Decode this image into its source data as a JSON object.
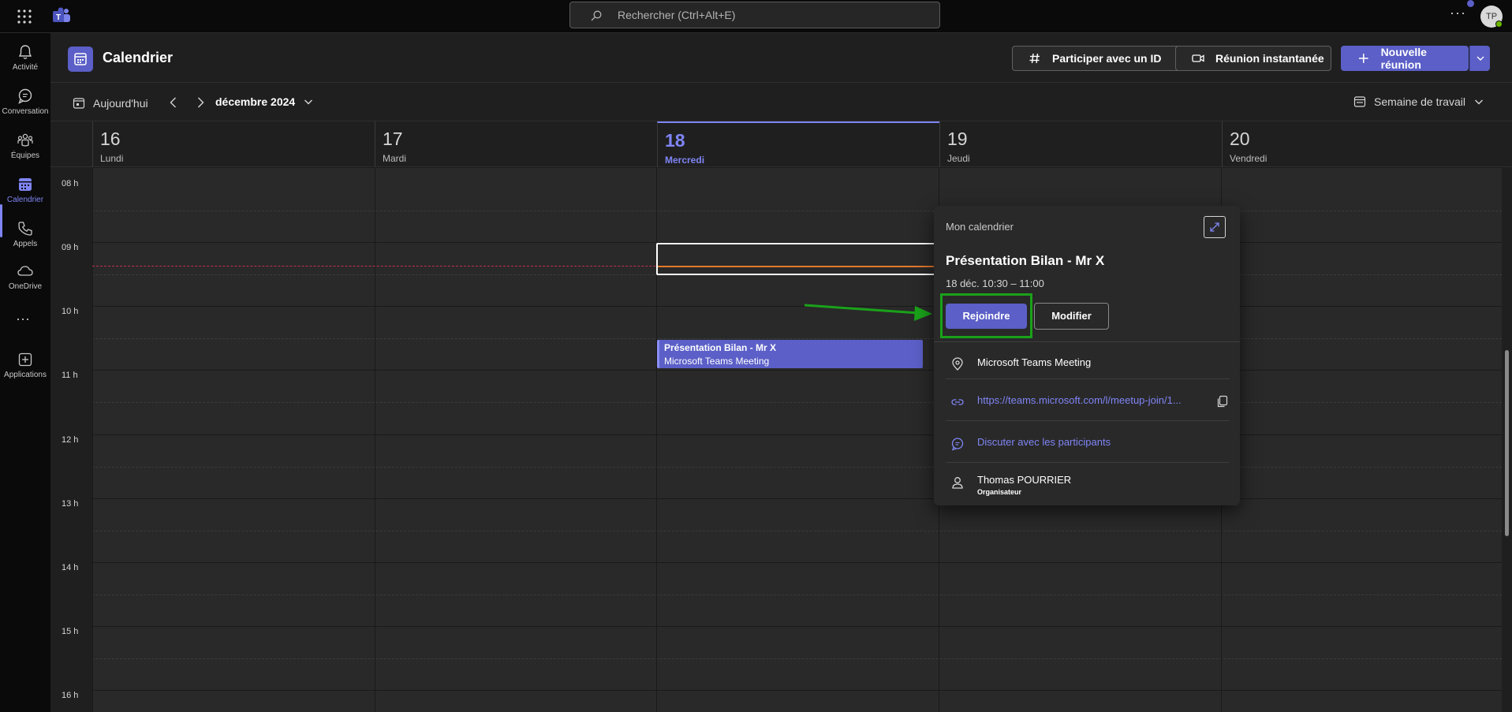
{
  "topbar": {
    "search_placeholder": "Rechercher (Ctrl+Alt+E)",
    "more": "···",
    "avatar_initials": "TP"
  },
  "rail": {
    "items": [
      {
        "label": "Activité",
        "icon": "bell-icon"
      },
      {
        "label": "Conversation",
        "icon": "chat-icon"
      },
      {
        "label": "Équipes",
        "icon": "teams-icon"
      },
      {
        "label": "Calendrier",
        "icon": "calendar-icon",
        "active": true
      },
      {
        "label": "Appels",
        "icon": "phone-icon"
      },
      {
        "label": "OneDrive",
        "icon": "cloud-icon"
      },
      {
        "label": "Applications",
        "icon": "apps-icon"
      }
    ],
    "more": "···"
  },
  "header": {
    "title": "Calendrier",
    "join_id_label": "Participer avec un ID",
    "instant_label": "Réunion instantanée",
    "new_label": "Nouvelle réunion"
  },
  "toolbar": {
    "today_label": "Aujourd'hui",
    "month_label": "décembre 2024",
    "view_label": "Semaine de travail"
  },
  "days": [
    {
      "num": "16",
      "name": "Lundi"
    },
    {
      "num": "17",
      "name": "Mardi"
    },
    {
      "num": "18",
      "name": "Mercredi",
      "today": true
    },
    {
      "num": "19",
      "name": "Jeudi"
    },
    {
      "num": "20",
      "name": "Vendredi"
    }
  ],
  "hours": [
    "08 h",
    "09 h",
    "10 h",
    "11 h",
    "12 h",
    "13 h",
    "14 h",
    "15 h",
    "16 h"
  ],
  "event": {
    "title": "Présentation Bilan - Mr X",
    "location": "Microsoft Teams Meeting"
  },
  "popup": {
    "calendar_name": "Mon calendrier",
    "title": "Présentation Bilan - Mr X",
    "time": "18 déc. 10:30 – 11:00",
    "join_label": "Rejoindre",
    "edit_label": "Modifier",
    "location": "Microsoft Teams Meeting",
    "link": "https://teams.microsoft.com/l/meetup-join/1...",
    "chat_label": "Discuter avec les participants",
    "organizer_name": "Thomas POURRIER",
    "organizer_role": "Organisateur"
  },
  "colors": {
    "accent": "#5b5fc7",
    "accent_light": "#7f85f5",
    "highlight_green": "#1aa11a",
    "now_line": "#e3782d"
  }
}
